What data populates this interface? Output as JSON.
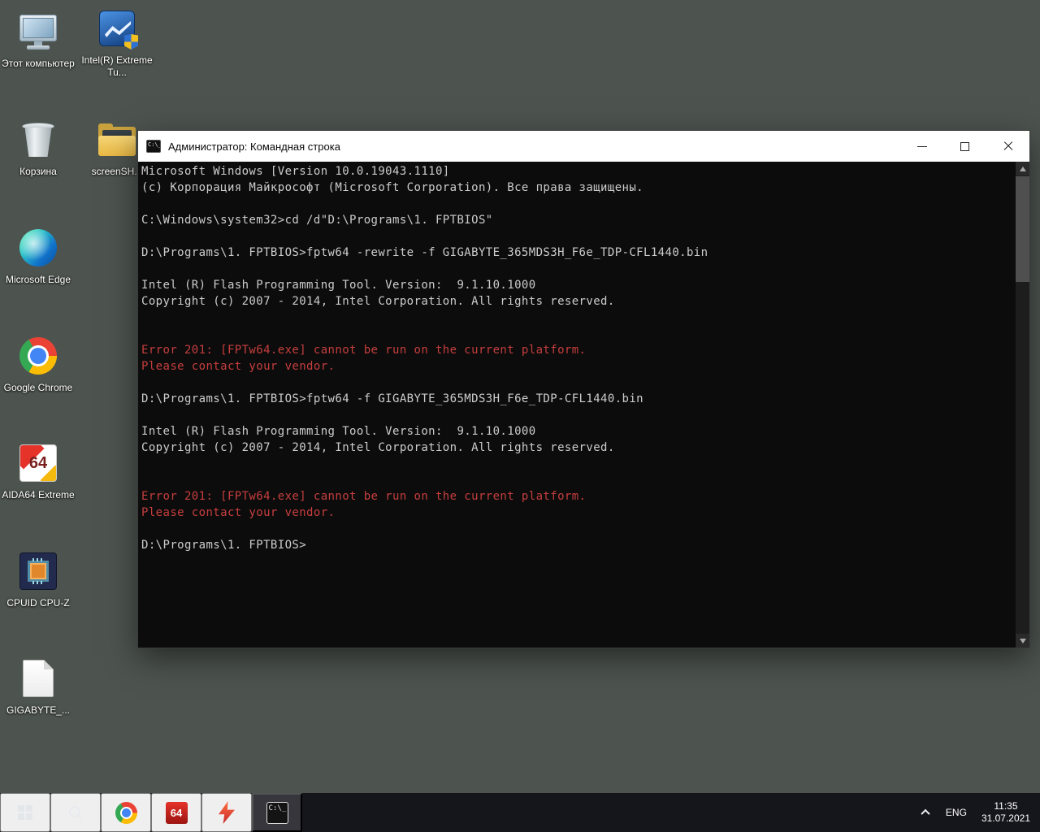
{
  "colors": {
    "desktop_background": "#4d544f",
    "taskbar_background": "#15151c",
    "titlebar_background": "#ffffff",
    "console_background": "#0c0c0c",
    "console_foreground": "#cccccc",
    "console_error": "#c73e3e",
    "taskbar_active_highlight": "rgba(255,255,255,0.14)"
  },
  "desktop": {
    "icons": [
      {
        "id": "this-pc",
        "label": "Этот компьютер"
      },
      {
        "id": "intel-xtu",
        "label": "Intel(R) Extreme Tu..."
      },
      {
        "id": "recycle-bin",
        "label": "Корзина"
      },
      {
        "id": "screenshots-folder",
        "label": "screenSH..."
      },
      {
        "id": "microsoft-edge",
        "label": "Microsoft Edge"
      },
      {
        "id": "google-chrome",
        "label": "Google Chrome"
      },
      {
        "id": "aida64-extreme",
        "label": "AIDA64 Extreme",
        "glyph": "64"
      },
      {
        "id": "cpuid-cpu-z",
        "label": "CPUID CPU-Z"
      },
      {
        "id": "gigabyte-bin-file",
        "label": "GIGABYTE_..."
      }
    ]
  },
  "cmd_window": {
    "title": "Администратор: Командная строка",
    "icon_glyph": "C:\\_",
    "controls": [
      "minimize",
      "maximize",
      "close"
    ],
    "console": {
      "foreground": "#cccccc",
      "error_color": "#c73e3e",
      "lines": [
        {
          "text": "Microsoft Windows [Version 10.0.19043.1110]",
          "color": "normal"
        },
        {
          "text": "(c) Корпорация Майкрософт (Microsoft Corporation). Все права защищены.",
          "color": "normal"
        },
        {
          "text": "",
          "color": "normal"
        },
        {
          "text": "C:\\Windows\\system32>cd /d\"D:\\Programs\\1. FPTBIOS\"",
          "color": "normal"
        },
        {
          "text": "",
          "color": "normal"
        },
        {
          "text": "D:\\Programs\\1. FPTBIOS>fptw64 -rewrite -f GIGABYTE_365MDS3H_F6e_TDP-CFL1440.bin",
          "color": "normal"
        },
        {
          "text": "",
          "color": "normal"
        },
        {
          "text": "Intel (R) Flash Programming Tool. Version:  9.1.10.1000",
          "color": "normal"
        },
        {
          "text": "Copyright (c) 2007 - 2014, Intel Corporation. All rights reserved.",
          "color": "normal"
        },
        {
          "text": "",
          "color": "normal"
        },
        {
          "text": "",
          "color": "normal"
        },
        {
          "text": "Error 201: [FPTw64.exe] cannot be run on the current platform.",
          "color": "error"
        },
        {
          "text": "Please contact your vendor.",
          "color": "error"
        },
        {
          "text": "",
          "color": "normal"
        },
        {
          "text": "D:\\Programs\\1. FPTBIOS>fptw64 -f GIGABYTE_365MDS3H_F6e_TDP-CFL1440.bin",
          "color": "normal"
        },
        {
          "text": "",
          "color": "normal"
        },
        {
          "text": "Intel (R) Flash Programming Tool. Version:  9.1.10.1000",
          "color": "normal"
        },
        {
          "text": "Copyright (c) 2007 - 2014, Intel Corporation. All rights reserved.",
          "color": "normal"
        },
        {
          "text": "",
          "color": "normal"
        },
        {
          "text": "",
          "color": "normal"
        },
        {
          "text": "Error 201: [FPTw64.exe] cannot be run on the current platform.",
          "color": "error"
        },
        {
          "text": "Please contact your vendor.",
          "color": "error"
        },
        {
          "text": "",
          "color": "normal"
        },
        {
          "text": "D:\\Programs\\1. FPTBIOS>",
          "color": "normal"
        }
      ]
    }
  },
  "taskbar": {
    "items": [
      {
        "id": "start"
      },
      {
        "id": "search"
      },
      {
        "id": "chrome"
      },
      {
        "id": "aida64",
        "glyph": "64"
      },
      {
        "id": "lightning-app"
      },
      {
        "id": "command-prompt",
        "active": true,
        "glyph": "C:\\_"
      }
    ],
    "tray": {
      "language": "ENG",
      "time": "11:35",
      "date": "31.07.2021"
    }
  }
}
